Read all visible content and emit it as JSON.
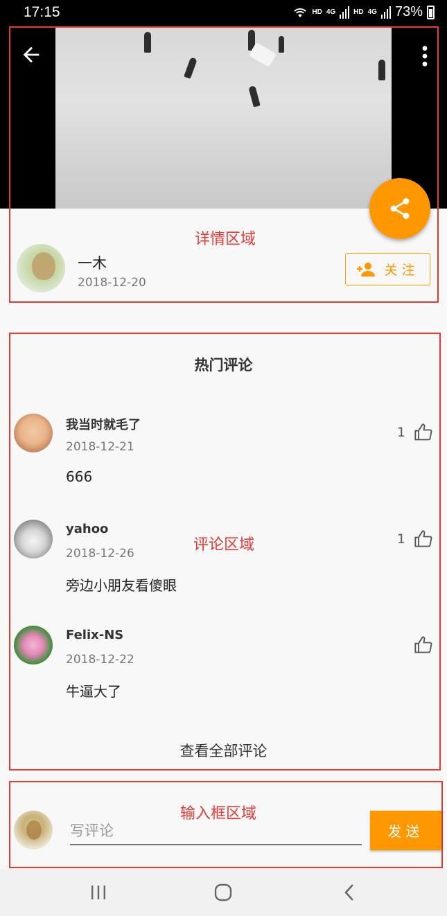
{
  "status_bar": {
    "time": "17:15",
    "network_1": "HD",
    "network_2": "HD",
    "signal_1": "4G",
    "signal_2": "4G",
    "battery": "73%"
  },
  "video": {
    "back_icon": "back-arrow-icon",
    "more_icon": "more-vert-icon"
  },
  "share_fab": {
    "icon": "share-icon",
    "color": "#ff9800"
  },
  "detail": {
    "author_name": "一木",
    "date": "2018-12-20",
    "follow_label": "关注",
    "follow_icon": "person-add-icon"
  },
  "comments": {
    "title": "热门评论",
    "items": [
      {
        "name": "我当时就毛了",
        "date": "2018-12-21",
        "text": "666",
        "likes": "1"
      },
      {
        "name": "yahoo",
        "date": "2018-12-26",
        "text": "旁边小朋友看傻眼",
        "likes": "1"
      },
      {
        "name": "Felix-NS",
        "date": "2018-12-22",
        "text": "牛逼大了",
        "likes": ""
      }
    ],
    "view_all": "查看全部评论"
  },
  "input": {
    "placeholder": "写评论",
    "send_label": "发送"
  },
  "annotations": {
    "detail_area": "详情区域",
    "comment_area": "评论区域",
    "input_area": "输入框区域",
    "color": "#e53935"
  },
  "accent_color": "#ff9800"
}
